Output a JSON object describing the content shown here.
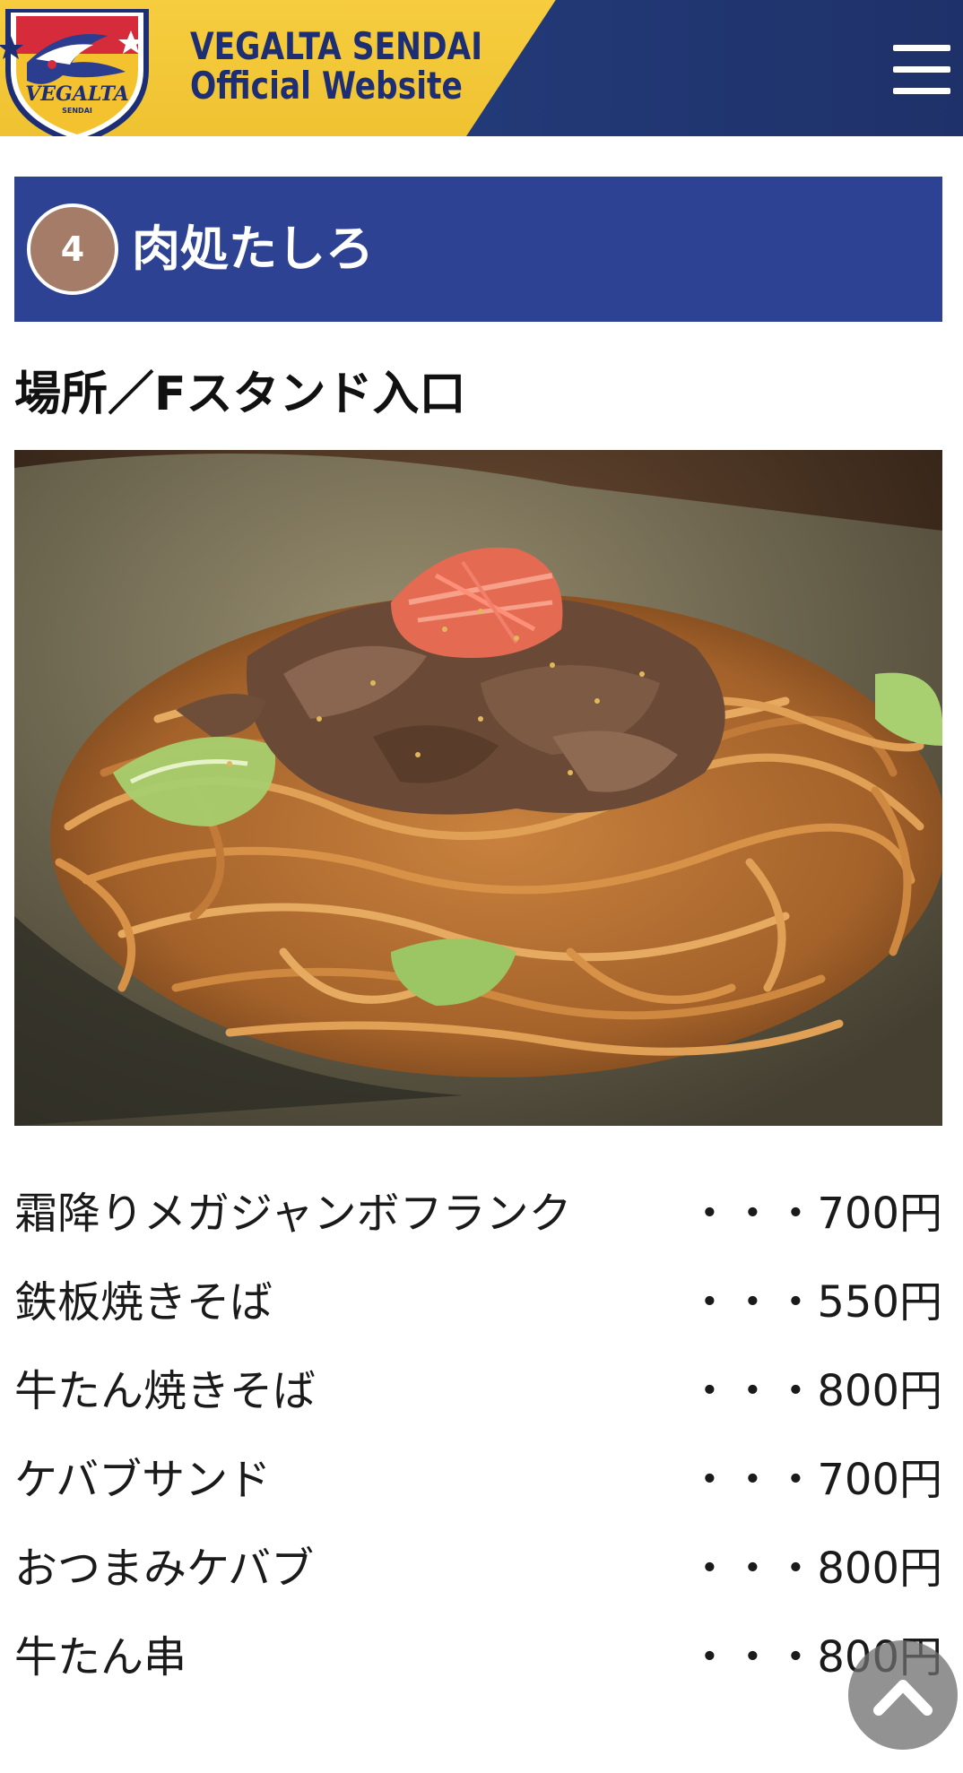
{
  "header": {
    "title_line1": "VEGALTA SENDAI",
    "title_line2": "Official Website",
    "logo_text": "VEGALTA",
    "logo_subtext": "SENDAI",
    "menu_icon": "hamburger-menu-icon"
  },
  "shop": {
    "number": "4",
    "name": "肉処たしろ",
    "location": "場所／Fスタンド入口"
  },
  "photo": {
    "subject": "yakisoba-photo"
  },
  "menu": {
    "items": [
      {
        "name": "霜降りメガジャンボフランク",
        "price": "・・・700円"
      },
      {
        "name": "鉄板焼きそば",
        "price": "・・・550円"
      },
      {
        "name": "牛たん焼きそば",
        "price": "・・・800円"
      },
      {
        "name": "ケバブサンド",
        "price": "・・・700円"
      },
      {
        "name": "おつまみケバブ",
        "price": "・・・800円"
      },
      {
        "name": "牛たん串",
        "price": "・・・800円"
      }
    ]
  },
  "colors": {
    "header_yellow": "#f6cd3f",
    "header_navy": "#20346e",
    "banner_blue": "#2e4294",
    "badge_brown": "#a57c68"
  }
}
